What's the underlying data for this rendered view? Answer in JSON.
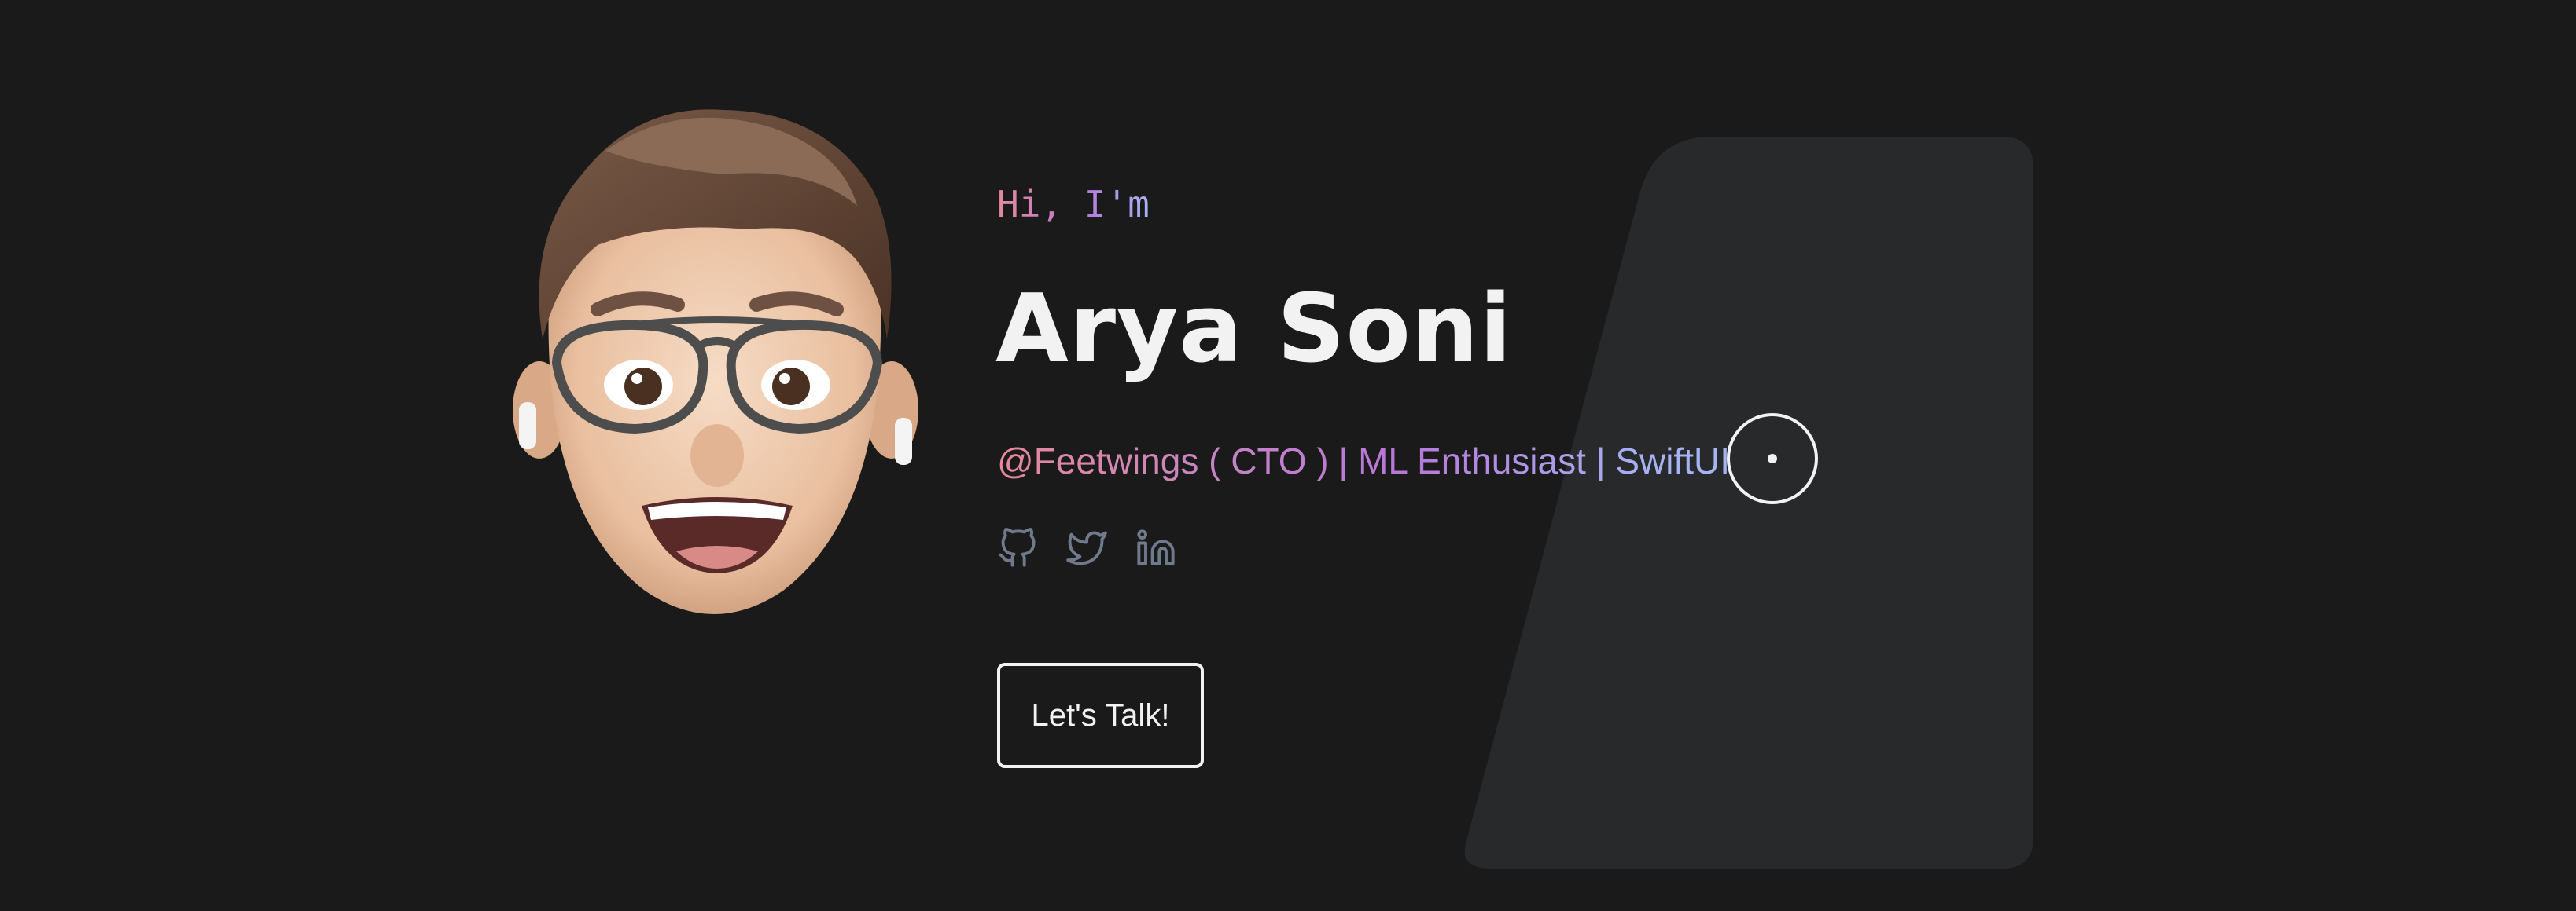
{
  "hero": {
    "greeting": "Hi, I'm",
    "name": "Arya Soni",
    "tagline": "@Feetwings ( CTO ) | ML Enthusiast | SwiftUI",
    "cta_label": "Let's Talk!"
  },
  "social_links": [
    {
      "icon": "github-icon"
    },
    {
      "icon": "twitter-icon"
    },
    {
      "icon": "linkedin-icon"
    }
  ],
  "colors": {
    "background": "#1a1a1a",
    "card": "#28292b",
    "text": "#f2f2f2",
    "gradient_start": "#e6899b",
    "gradient_mid": "#b877d9",
    "gradient_end": "#a6b4f4",
    "icon": "#6f7a8c"
  }
}
